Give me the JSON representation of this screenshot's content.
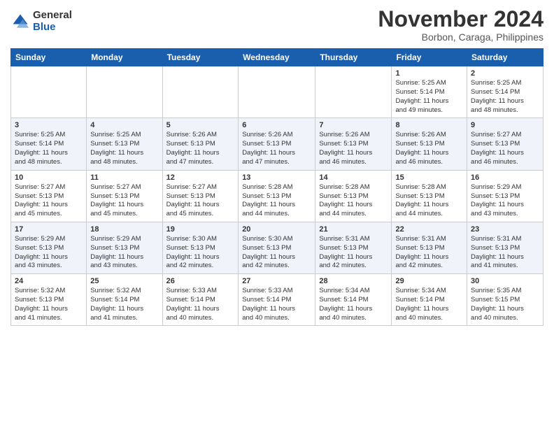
{
  "header": {
    "logo_general": "General",
    "logo_blue": "Blue",
    "month_title": "November 2024",
    "location": "Borbon, Caraga, Philippines"
  },
  "weekdays": [
    "Sunday",
    "Monday",
    "Tuesday",
    "Wednesday",
    "Thursday",
    "Friday",
    "Saturday"
  ],
  "weeks": [
    [
      {
        "day": "",
        "info": ""
      },
      {
        "day": "",
        "info": ""
      },
      {
        "day": "",
        "info": ""
      },
      {
        "day": "",
        "info": ""
      },
      {
        "day": "",
        "info": ""
      },
      {
        "day": "1",
        "info": "Sunrise: 5:25 AM\nSunset: 5:14 PM\nDaylight: 11 hours\nand 49 minutes."
      },
      {
        "day": "2",
        "info": "Sunrise: 5:25 AM\nSunset: 5:14 PM\nDaylight: 11 hours\nand 48 minutes."
      }
    ],
    [
      {
        "day": "3",
        "info": "Sunrise: 5:25 AM\nSunset: 5:14 PM\nDaylight: 11 hours\nand 48 minutes."
      },
      {
        "day": "4",
        "info": "Sunrise: 5:25 AM\nSunset: 5:13 PM\nDaylight: 11 hours\nand 48 minutes."
      },
      {
        "day": "5",
        "info": "Sunrise: 5:26 AM\nSunset: 5:13 PM\nDaylight: 11 hours\nand 47 minutes."
      },
      {
        "day": "6",
        "info": "Sunrise: 5:26 AM\nSunset: 5:13 PM\nDaylight: 11 hours\nand 47 minutes."
      },
      {
        "day": "7",
        "info": "Sunrise: 5:26 AM\nSunset: 5:13 PM\nDaylight: 11 hours\nand 46 minutes."
      },
      {
        "day": "8",
        "info": "Sunrise: 5:26 AM\nSunset: 5:13 PM\nDaylight: 11 hours\nand 46 minutes."
      },
      {
        "day": "9",
        "info": "Sunrise: 5:27 AM\nSunset: 5:13 PM\nDaylight: 11 hours\nand 46 minutes."
      }
    ],
    [
      {
        "day": "10",
        "info": "Sunrise: 5:27 AM\nSunset: 5:13 PM\nDaylight: 11 hours\nand 45 minutes."
      },
      {
        "day": "11",
        "info": "Sunrise: 5:27 AM\nSunset: 5:13 PM\nDaylight: 11 hours\nand 45 minutes."
      },
      {
        "day": "12",
        "info": "Sunrise: 5:27 AM\nSunset: 5:13 PM\nDaylight: 11 hours\nand 45 minutes."
      },
      {
        "day": "13",
        "info": "Sunrise: 5:28 AM\nSunset: 5:13 PM\nDaylight: 11 hours\nand 44 minutes."
      },
      {
        "day": "14",
        "info": "Sunrise: 5:28 AM\nSunset: 5:13 PM\nDaylight: 11 hours\nand 44 minutes."
      },
      {
        "day": "15",
        "info": "Sunrise: 5:28 AM\nSunset: 5:13 PM\nDaylight: 11 hours\nand 44 minutes."
      },
      {
        "day": "16",
        "info": "Sunrise: 5:29 AM\nSunset: 5:13 PM\nDaylight: 11 hours\nand 43 minutes."
      }
    ],
    [
      {
        "day": "17",
        "info": "Sunrise: 5:29 AM\nSunset: 5:13 PM\nDaylight: 11 hours\nand 43 minutes."
      },
      {
        "day": "18",
        "info": "Sunrise: 5:29 AM\nSunset: 5:13 PM\nDaylight: 11 hours\nand 43 minutes."
      },
      {
        "day": "19",
        "info": "Sunrise: 5:30 AM\nSunset: 5:13 PM\nDaylight: 11 hours\nand 42 minutes."
      },
      {
        "day": "20",
        "info": "Sunrise: 5:30 AM\nSunset: 5:13 PM\nDaylight: 11 hours\nand 42 minutes."
      },
      {
        "day": "21",
        "info": "Sunrise: 5:31 AM\nSunset: 5:13 PM\nDaylight: 11 hours\nand 42 minutes."
      },
      {
        "day": "22",
        "info": "Sunrise: 5:31 AM\nSunset: 5:13 PM\nDaylight: 11 hours\nand 42 minutes."
      },
      {
        "day": "23",
        "info": "Sunrise: 5:31 AM\nSunset: 5:13 PM\nDaylight: 11 hours\nand 41 minutes."
      }
    ],
    [
      {
        "day": "24",
        "info": "Sunrise: 5:32 AM\nSunset: 5:13 PM\nDaylight: 11 hours\nand 41 minutes."
      },
      {
        "day": "25",
        "info": "Sunrise: 5:32 AM\nSunset: 5:14 PM\nDaylight: 11 hours\nand 41 minutes."
      },
      {
        "day": "26",
        "info": "Sunrise: 5:33 AM\nSunset: 5:14 PM\nDaylight: 11 hours\nand 40 minutes."
      },
      {
        "day": "27",
        "info": "Sunrise: 5:33 AM\nSunset: 5:14 PM\nDaylight: 11 hours\nand 40 minutes."
      },
      {
        "day": "28",
        "info": "Sunrise: 5:34 AM\nSunset: 5:14 PM\nDaylight: 11 hours\nand 40 minutes."
      },
      {
        "day": "29",
        "info": "Sunrise: 5:34 AM\nSunset: 5:14 PM\nDaylight: 11 hours\nand 40 minutes."
      },
      {
        "day": "30",
        "info": "Sunrise: 5:35 AM\nSunset: 5:15 PM\nDaylight: 11 hours\nand 40 minutes."
      }
    ]
  ]
}
